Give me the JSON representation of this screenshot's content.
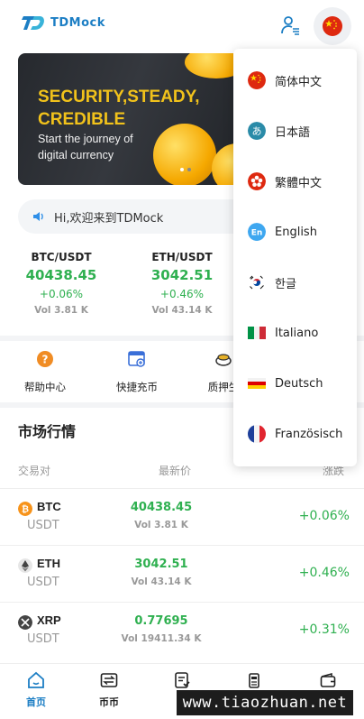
{
  "header": {
    "logo_text": "TDMock"
  },
  "banner": {
    "headline_1": "SECURITY,STEADY,",
    "headline_2": "CREDIBLE",
    "sub_1": "Start the journey of",
    "sub_2": "digital currency"
  },
  "notice": {
    "text": "Hi,欢迎来到TDMock"
  },
  "tickers": [
    {
      "pair": "BTC/USDT",
      "price": "40438.45",
      "change": "+0.06%",
      "volume": "Vol 3.81 K"
    },
    {
      "pair": "ETH/USDT",
      "price": "3042.51",
      "change": "+0.46%",
      "volume": "Vol 43.14 K"
    }
  ],
  "quick_actions": [
    {
      "label": "帮助中心",
      "icon": "help-icon"
    },
    {
      "label": "快捷充币",
      "icon": "deposit-icon"
    },
    {
      "label": "质押生",
      "icon": "staking-icon"
    }
  ],
  "market": {
    "title": "市场行情",
    "col_pair": "交易对",
    "col_price": "最新价",
    "col_change": "涨跌",
    "rows": [
      {
        "base": "BTC",
        "quote": "USDT",
        "price": "40438.45",
        "volume": "Vol 3.81 K",
        "change": "+0.06%",
        "icon": "btc-icon",
        "color": "#f7931a"
      },
      {
        "base": "ETH",
        "quote": "USDT",
        "price": "3042.51",
        "volume": "Vol 43.14 K",
        "change": "+0.46%",
        "icon": "eth-icon",
        "color": "#555555"
      },
      {
        "base": "XRP",
        "quote": "USDT",
        "price": "0.77695",
        "volume": "Vol 19411.34 K",
        "change": "+0.31%",
        "icon": "xrp-icon",
        "color": "#444444"
      }
    ]
  },
  "tabbar": [
    {
      "label": "首页",
      "icon": "home-icon",
      "active": true
    },
    {
      "label": "币币",
      "icon": "exchange-icon"
    },
    {
      "label": "",
      "icon": "orders-icon"
    },
    {
      "label": "",
      "icon": "contract-icon"
    },
    {
      "label": "",
      "icon": "wallet-icon"
    }
  ],
  "languages": [
    {
      "label": "简体中文",
      "flag": "cn-flag-icon"
    },
    {
      "label": "日本語",
      "flag": "jp-flag-icon"
    },
    {
      "label": "繁體中文",
      "flag": "hk-flag-icon"
    },
    {
      "label": "English",
      "flag": "en-flag-icon"
    },
    {
      "label": "한글",
      "flag": "kr-flag-icon"
    },
    {
      "label": "Italiano",
      "flag": "it-flag-icon"
    },
    {
      "label": "Deutsch",
      "flag": "de-flag-icon"
    },
    {
      "label": "Französisch",
      "flag": "fr-flag-icon"
    }
  ],
  "watermark": "www.tiaozhuan.net",
  "colors": {
    "brand": "#1c7ec4",
    "up": "#2fb050",
    "banner_accent": "#f1c21b"
  }
}
